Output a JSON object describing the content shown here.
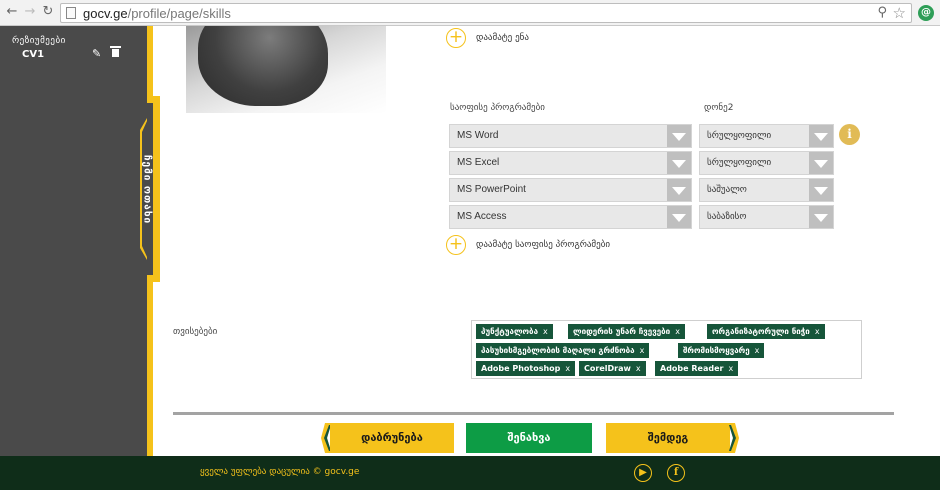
{
  "browser": {
    "url_host": "gocv.ge",
    "url_path": "/profile/page/skills"
  },
  "sidebar": {
    "section_label": "რეზიუმეები",
    "cv_name": "CV1",
    "tab_label": "ჩემი ოთახი"
  },
  "languages": {
    "add_label": "დაამატე ენა"
  },
  "office": {
    "header_program": "საოფისე პროგრამები",
    "header_level": "დონე2",
    "rows": [
      {
        "program": "MS Word",
        "level": "სრულყოფილი"
      },
      {
        "program": "MS Excel",
        "level": "სრულყოფილი"
      },
      {
        "program": "MS PowerPoint",
        "level": "საშუალო"
      },
      {
        "program": "MS Access",
        "level": "საბაზისო"
      }
    ],
    "add_label": "დაამატე საოფისე პროგრამები"
  },
  "traits": {
    "label": "თვისებები",
    "remove_symbol": "x",
    "tags": [
      "პუნქტუალობა",
      "ლიდერის უნარ ჩვევები",
      "ორგანიზატორული ნიჭი",
      "პასუხისმგებლობის მაღალი გრძნობა",
      "შრომისმოყვარე",
      "Adobe Photoshop",
      "CorelDraw",
      "Adobe Reader"
    ]
  },
  "buttons": {
    "back": "დაბრუნება",
    "save": "შენახვა",
    "next": "შემდეგ"
  },
  "footer": {
    "copyright": "ყველა უფლება დაცულია © gocv.ge",
    "youtube_icon": "youtube-icon",
    "facebook_icon": "facebook-icon"
  },
  "colors": {
    "accent_yellow": "#f5c21b",
    "tag_green": "#16553a",
    "save_green": "#0d9c45",
    "footer_bg": "#0f2d19",
    "sidebar_bg": "#4a4a4a"
  }
}
